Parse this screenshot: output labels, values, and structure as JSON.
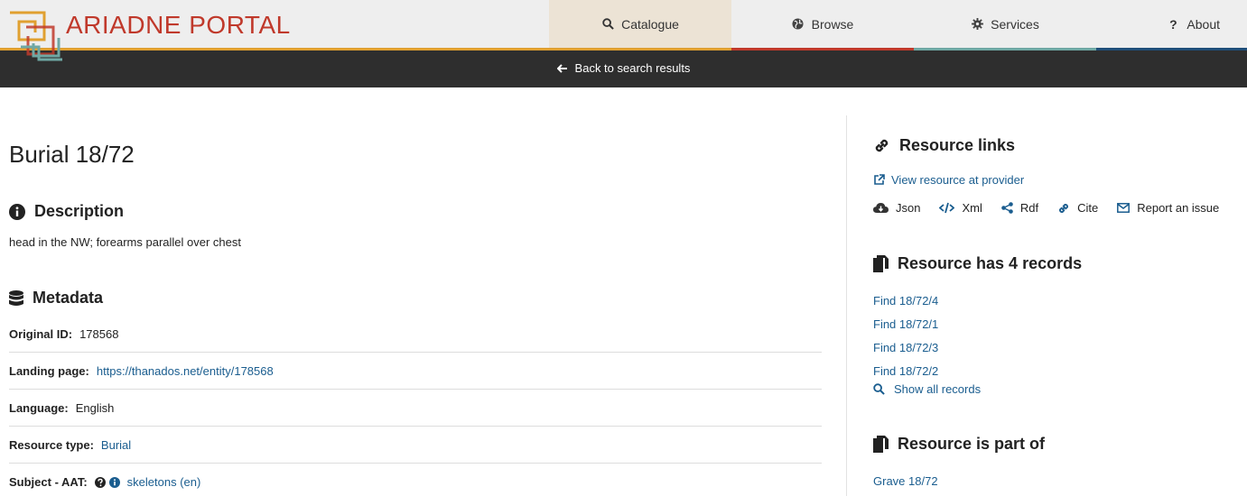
{
  "header": {
    "brand": "ARIADNE PORTAL",
    "logo_icon": "ariadne-logo-icon",
    "nav": [
      {
        "label": "Catalogue",
        "icon": "search-icon"
      },
      {
        "label": "Browse",
        "icon": "globe-icon"
      },
      {
        "label": "Services",
        "icon": "gear-icon"
      },
      {
        "label": "About",
        "icon": "question-icon"
      }
    ],
    "colors": {
      "brand": "#c0392b",
      "stripe_catalogue": "#e0a030",
      "stripe_browse": "#c0392b",
      "stripe_services": "#6fa8a4",
      "stripe_about": "#1f4e79"
    }
  },
  "subbar": {
    "back_label": "Back to search results",
    "back_icon": "arrow-left-icon"
  },
  "main": {
    "title": "Burial 18/72",
    "description": {
      "heading": "Description",
      "icon": "info-circle-icon",
      "text": "head in the NW; forearms parallel over chest"
    },
    "metadata": {
      "heading": "Metadata",
      "icon": "database-icon",
      "rows": [
        {
          "label": "Original ID:",
          "value": "178568"
        },
        {
          "label": "Landing page:",
          "value": "https://thanados.net/entity/178568"
        },
        {
          "label": "Language:",
          "value": "English"
        },
        {
          "label": "Resource type:",
          "value": "Burial"
        },
        {
          "label": "Subject - AAT:",
          "value": "skeletons (en)"
        }
      ]
    }
  },
  "sidebar": {
    "links": {
      "heading": "Resource links",
      "icon": "link-icon",
      "view_label": "View resource at provider",
      "actions": [
        {
          "label": "Json",
          "icon": "cloud-download-icon"
        },
        {
          "label": "Xml",
          "icon": "code-icon"
        },
        {
          "label": "Rdf",
          "icon": "share-icon"
        },
        {
          "label": "Cite",
          "icon": "link-icon"
        },
        {
          "label": "Report an issue",
          "icon": "envelope-icon"
        }
      ]
    },
    "records": {
      "heading": "Resource has 4 records",
      "icon": "copy-icon",
      "items": [
        "Find 18/72/4",
        "Find 18/72/1",
        "Find 18/72/3",
        "Find 18/72/2"
      ],
      "show_all": "Show all records"
    },
    "part_of": {
      "heading": "Resource is part of",
      "icon": "copy-icon",
      "items": [
        "Grave 18/72"
      ]
    }
  }
}
